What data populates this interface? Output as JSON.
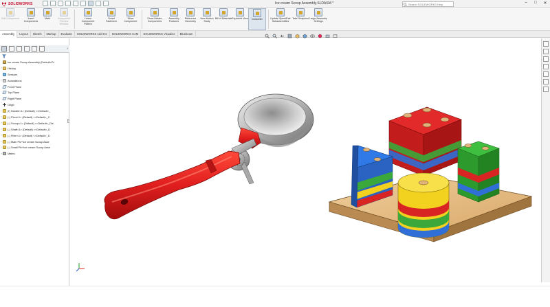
{
  "app": {
    "logo_text": "SOLIDWORKS",
    "window_title": "Ice cream Scoop Assembly.SLDASM *",
    "search_placeholder": "Search SOLIDWORKS Help",
    "brand_color": "#c8102e"
  },
  "ribbon": {
    "buttons": [
      {
        "label": "Edit Component",
        "enabled": false
      },
      {
        "label": "Insert Components",
        "enabled": true
      },
      {
        "label": "Mate",
        "enabled": true
      },
      {
        "label": "Component Preview Window",
        "enabled": false
      },
      {
        "label": "Linear Component Pattern",
        "enabled": true
      },
      {
        "label": "Smart Fasteners",
        "enabled": true
      },
      {
        "label": "Move Component",
        "enabled": true
      },
      {
        "label": "Show Hidden Components",
        "enabled": true
      },
      {
        "label": "Assembly Features",
        "enabled": true
      },
      {
        "label": "Reference Geometry",
        "enabled": true
      },
      {
        "label": "New Motion Study",
        "enabled": true
      },
      {
        "label": "Bill of Materials",
        "enabled": true
      },
      {
        "label": "Exploded View",
        "enabled": true
      },
      {
        "label": "Instant3D",
        "enabled": true,
        "active": true
      },
      {
        "label": "Update SpeedPak Subassemblies",
        "enabled": true
      },
      {
        "label": "Take Snapshot",
        "enabled": true
      },
      {
        "label": "Large Assembly Settings",
        "enabled": true
      }
    ]
  },
  "tabs": [
    {
      "label": "Assembly",
      "active": true
    },
    {
      "label": "Layout"
    },
    {
      "label": "Sketch"
    },
    {
      "label": "Markup"
    },
    {
      "label": "Evaluate"
    },
    {
      "label": "SOLIDWORKS Add-Ins"
    },
    {
      "label": "SOLIDWORKS CAM"
    },
    {
      "label": "SOLIDWORKS Visualize"
    },
    {
      "label": "Bluebeam"
    }
  ],
  "tree": {
    "root": "Ice cream Scoop Assembly (Default<Di",
    "items": [
      {
        "label": "History",
        "icon": "folder",
        "expandable": true
      },
      {
        "label": "Sensors",
        "icon": "sensor",
        "expandable": false
      },
      {
        "label": "Annotations",
        "icon": "annot",
        "expandable": true
      },
      {
        "label": "Front Plane",
        "icon": "plane",
        "expandable": false
      },
      {
        "label": "Top Plane",
        "icon": "plane",
        "expandable": false
      },
      {
        "label": "Right Plane",
        "icon": "plane",
        "expandable": false
      },
      {
        "label": "Origin",
        "icon": "origin",
        "expandable": false
      },
      {
        "label": "(f) Handle<1> (Default) <<Default>_",
        "icon": "part",
        "expandable": true
      },
      {
        "label": "(-) Pivot<1> (Default) <<Default>_C",
        "icon": "part",
        "expandable": true
      },
      {
        "label": "(-) Scoop<1> (Default) <<Default>_Dis",
        "icon": "part",
        "expandable": true
      },
      {
        "label": "(-) Shaft<1> (Default) <<Default>_D",
        "icon": "part",
        "expandable": true
      },
      {
        "label": "(-) Fliter<1> (Default) <<Default>_D",
        "icon": "part",
        "expandable": true
      },
      {
        "label": "(-) Main Pin^Ice cream Scoop Asse",
        "icon": "part",
        "expandable": true
      },
      {
        "label": "(-) Small Pin^Ice cream Scoop Asse",
        "icon": "part",
        "expandable": true
      },
      {
        "label": "Mates",
        "icon": "mates",
        "expandable": true
      }
    ]
  },
  "colors": {
    "handle_red": "#e02020",
    "metal": "#b8b8b8",
    "toy_red": "#d92424",
    "toy_blue": "#2f6fd6",
    "toy_green": "#3aa83a",
    "toy_yellow": "#f2d21f",
    "toy_base": "#d8b07a"
  }
}
